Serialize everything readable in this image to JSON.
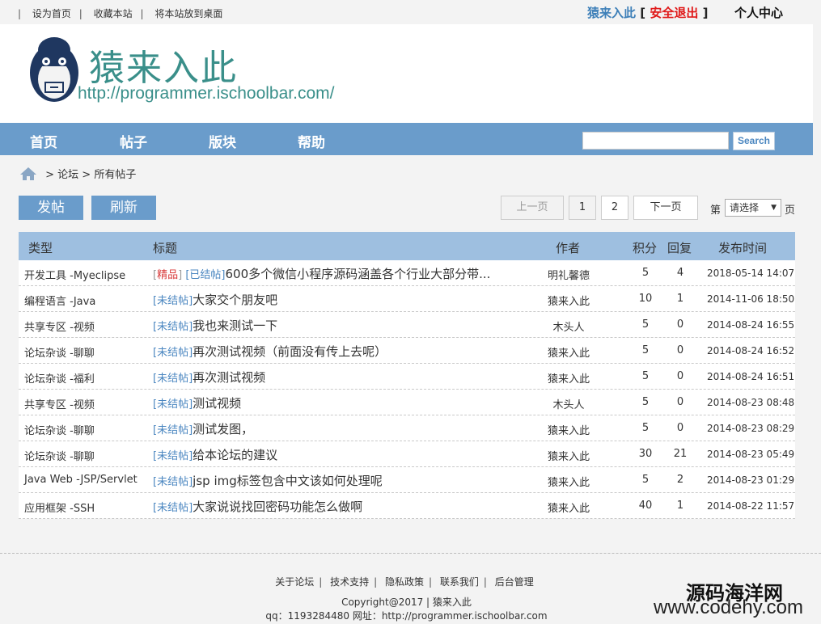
{
  "topbar": {
    "links": [
      "设为首页",
      "收藏本站",
      "将本站放到桌面"
    ],
    "user_name": "猿来入此",
    "logout": "安全退出",
    "bracket_open": "[",
    "bracket_close": "]",
    "user_center": "个人中心"
  },
  "header": {
    "title": "猿来入此",
    "url": "http://programmer.ischoolbar.com/"
  },
  "nav": {
    "items": [
      "首页",
      "帖子",
      "版块",
      "帮助"
    ],
    "search_value": "",
    "search_button": "Search"
  },
  "breadcrumb": {
    "text": "> 论坛 > 所有帖子"
  },
  "actions": {
    "post": "发帖",
    "refresh": "刷新"
  },
  "pager": {
    "prev": "上一页",
    "pages": [
      "1",
      "2"
    ],
    "next": "下一页",
    "label_before": "第",
    "select_value": "请选择",
    "label_after": "页"
  },
  "table": {
    "headers": {
      "type": "类型",
      "title": "标题",
      "author": "作者",
      "score": "积分",
      "reply": "回复",
      "time": "发布时间"
    },
    "rows": [
      {
        "type": "开发工具 -Myeclipse",
        "tag1": "精品",
        "tag2": "已结帖",
        "title": "600多个微信小程序源码涵盖各个行业大部分带...",
        "author": "明礼馨德",
        "score": "5",
        "reply": "4",
        "time": "2018-05-14 14:07"
      },
      {
        "type": "编程语言 -Java",
        "tag1": "",
        "tag2": "未结帖",
        "title": "大家交个朋友吧",
        "author": "猿来入此",
        "score": "10",
        "reply": "1",
        "time": "2014-11-06 18:50"
      },
      {
        "type": "共享专区 -视频",
        "tag1": "",
        "tag2": "未结帖",
        "title": "我也来测试一下",
        "author": "木头人",
        "score": "5",
        "reply": "0",
        "time": "2014-08-24 16:55"
      },
      {
        "type": "论坛杂谈 -聊聊",
        "tag1": "",
        "tag2": "未结帖",
        "title": "再次测试视频（前面没有传上去呢）",
        "author": "猿来入此",
        "score": "5",
        "reply": "0",
        "time": "2014-08-24 16:52"
      },
      {
        "type": "论坛杂谈 -福利",
        "tag1": "",
        "tag2": "未结帖",
        "title": "再次测试视频",
        "author": "猿来入此",
        "score": "5",
        "reply": "0",
        "time": "2014-08-24 16:51"
      },
      {
        "type": "共享专区 -视频",
        "tag1": "",
        "tag2": "未结帖",
        "title": "测试视频",
        "author": "木头人",
        "score": "5",
        "reply": "0",
        "time": "2014-08-23 08:48"
      },
      {
        "type": "论坛杂谈 -聊聊",
        "tag1": "",
        "tag2": "未结帖",
        "title": "测试发图，",
        "author": "猿来入此",
        "score": "5",
        "reply": "0",
        "time": "2014-08-23 08:29"
      },
      {
        "type": "论坛杂谈 -聊聊",
        "tag1": "",
        "tag2": "未结帖",
        "title": "给本论坛的建议",
        "author": "猿来入此",
        "score": "30",
        "reply": "21",
        "time": "2014-08-23 05:49"
      },
      {
        "type": "Java Web -JSP/Servlet",
        "tag1": "",
        "tag2": "未结帖",
        "title": "jsp img标签包含中文该如何处理呢",
        "author": "猿来入此",
        "score": "5",
        "reply": "2",
        "time": "2014-08-23 01:29"
      },
      {
        "type": "应用框架 -SSH",
        "tag1": "",
        "tag2": "未结帖",
        "title": "大家说说找回密码功能怎么做啊",
        "author": "猿来入此",
        "score": "40",
        "reply": "1",
        "time": "2014-08-22 11:57"
      }
    ]
  },
  "footer": {
    "links": [
      "关于论坛",
      "技术支持",
      "隐私政策",
      "联系我们",
      "后台管理"
    ],
    "copyright": "Copyright@2017 | 猿来入此",
    "contact": "qq：1193284480 网址：http://programmer.ischoolbar.com"
  },
  "watermark": {
    "line1": "源码海洋网",
    "line2": "www.codehy.com"
  },
  "icons": {
    "home": "home-icon",
    "logo": "monkey-logo",
    "dropdown": "chevron-down-icon"
  },
  "colors": {
    "nav_bg": "#6a9ccb",
    "table_head": "#9ebfe0",
    "brand_text": "#3a8f8a",
    "logout": "#e01818",
    "tag_red": "#d83a3a",
    "tag_blue": "#4a86c0"
  }
}
